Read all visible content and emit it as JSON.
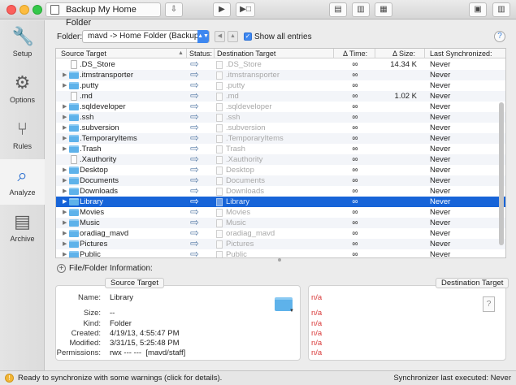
{
  "window": {
    "title": "Backup My Home Folder"
  },
  "toolbar": {
    "buttons": [
      "save-icon",
      "play-icon",
      "sync-preview-icon",
      "document-icon",
      "document-icon",
      "document-icon",
      "layout-icon",
      "sidebar-icon"
    ]
  },
  "sidebar": {
    "items": [
      {
        "label": "Setup",
        "icon": "wrench-icon"
      },
      {
        "label": "Options",
        "icon": "gear-icon"
      },
      {
        "label": "Rules",
        "icon": "fork-icon"
      },
      {
        "label": "Analyze",
        "icon": "magnify-doc-icon"
      },
      {
        "label": "Archive",
        "icon": "archive-box-icon"
      }
    ],
    "active": "Analyze"
  },
  "folder": {
    "label": "Folder:",
    "selected": "mavd -> Home Folder (Backup)",
    "show_all_label": "Show all entries",
    "show_all_checked": true
  },
  "table": {
    "headers": {
      "source": "Source Target",
      "status": "Status:",
      "destination": "Destination Target",
      "dtime": "Δ Time:",
      "dsize": "Δ Size:",
      "last_sync": "Last Synchronized:"
    },
    "rows": [
      {
        "src": ".DS_Store",
        "kind": "file",
        "expand": false,
        "dst": ".DS_Store",
        "dtime": "∞",
        "dsize": "14.34 K",
        "sync": "Never"
      },
      {
        "src": ".itmstransporter",
        "kind": "folder",
        "expand": true,
        "dst": ".itmstransporter",
        "dtime": "∞",
        "dsize": "",
        "sync": "Never"
      },
      {
        "src": ".putty",
        "kind": "folder",
        "expand": true,
        "dst": ".putty",
        "dtime": "∞",
        "dsize": "",
        "sync": "Never"
      },
      {
        "src": ".md",
        "kind": "file",
        "expand": false,
        "dst": ".md",
        "dtime": "∞",
        "dsize": "1.02 K",
        "sync": "Never"
      },
      {
        "src": ".sqldeveloper",
        "kind": "folder",
        "expand": true,
        "dst": ".sqldeveloper",
        "dtime": "∞",
        "dsize": "",
        "sync": "Never"
      },
      {
        "src": ".ssh",
        "kind": "folder",
        "expand": true,
        "dst": ".ssh",
        "dtime": "∞",
        "dsize": "",
        "sync": "Never"
      },
      {
        "src": ".subversion",
        "kind": "folder",
        "expand": true,
        "dst": ".subversion",
        "dtime": "∞",
        "dsize": "",
        "sync": "Never"
      },
      {
        "src": ".TemporaryItems",
        "kind": "folder",
        "expand": true,
        "dst": ".TemporaryItems",
        "dtime": "∞",
        "dsize": "",
        "sync": "Never"
      },
      {
        "src": ".Trash",
        "kind": "folder",
        "expand": true,
        "dst": "Trash",
        "dtime": "∞",
        "dsize": "",
        "sync": "Never"
      },
      {
        "src": ".Xauthority",
        "kind": "file",
        "expand": false,
        "dst": ".Xauthority",
        "dtime": "∞",
        "dsize": "",
        "sync": "Never"
      },
      {
        "src": "Desktop",
        "kind": "folder",
        "expand": true,
        "dst": "Desktop",
        "dtime": "∞",
        "dsize": "",
        "sync": "Never"
      },
      {
        "src": "Documents",
        "kind": "folder",
        "expand": true,
        "dst": "Documents",
        "dtime": "∞",
        "dsize": "",
        "sync": "Never"
      },
      {
        "src": "Downloads",
        "kind": "folder",
        "expand": true,
        "dst": "Downloads",
        "dtime": "∞",
        "dsize": "",
        "sync": "Never"
      },
      {
        "src": "Library",
        "kind": "folder",
        "expand": true,
        "dst": "Library",
        "dtime": "∞",
        "dsize": "",
        "sync": "Never",
        "selected": true
      },
      {
        "src": "Movies",
        "kind": "folder",
        "expand": true,
        "dst": "Movies",
        "dtime": "∞",
        "dsize": "",
        "sync": "Never"
      },
      {
        "src": "Music",
        "kind": "folder",
        "expand": true,
        "dst": "Music",
        "dtime": "∞",
        "dsize": "",
        "sync": "Never"
      },
      {
        "src": "oradiag_mavd",
        "kind": "folder",
        "expand": true,
        "dst": "oradiag_mavd",
        "dtime": "∞",
        "dsize": "",
        "sync": "Never"
      },
      {
        "src": "Pictures",
        "kind": "folder",
        "expand": true,
        "dst": "Pictures",
        "dtime": "∞",
        "dsize": "",
        "sync": "Never"
      },
      {
        "src": "Public",
        "kind": "folder",
        "expand": true,
        "dst": "Public",
        "dtime": "∞",
        "dsize": "",
        "sync": "Never"
      }
    ]
  },
  "info": {
    "header": "File/Folder Information:",
    "source_tab": "Source Target",
    "destination_tab": "Destination Target",
    "labels": {
      "name": "Name:",
      "size": "Size:",
      "kind": "Kind:",
      "created": "Created:",
      "modified": "Modified:",
      "permissions": "Permissions:"
    },
    "source": {
      "name": "Library",
      "size": "--",
      "kind": "Folder",
      "created": "4/19/13, 4:55:47 PM",
      "modified": "3/31/15, 5:25:48 PM",
      "permissions": "rwx --- ---  [mavd/staff]"
    },
    "destination": {
      "name": "n/a",
      "size": "n/a",
      "kind": "n/a",
      "created": "n/a",
      "modified": "n/a",
      "permissions": "n/a"
    }
  },
  "status": {
    "message": "Ready to synchronize with some warnings (click for details).",
    "last_executed": "Synchronizer last executed:  Never"
  },
  "colors": {
    "selection": "#1764d8",
    "accent": "#3d87f0",
    "folder": "#5eb2ea",
    "na_red": "#d93a3a"
  }
}
